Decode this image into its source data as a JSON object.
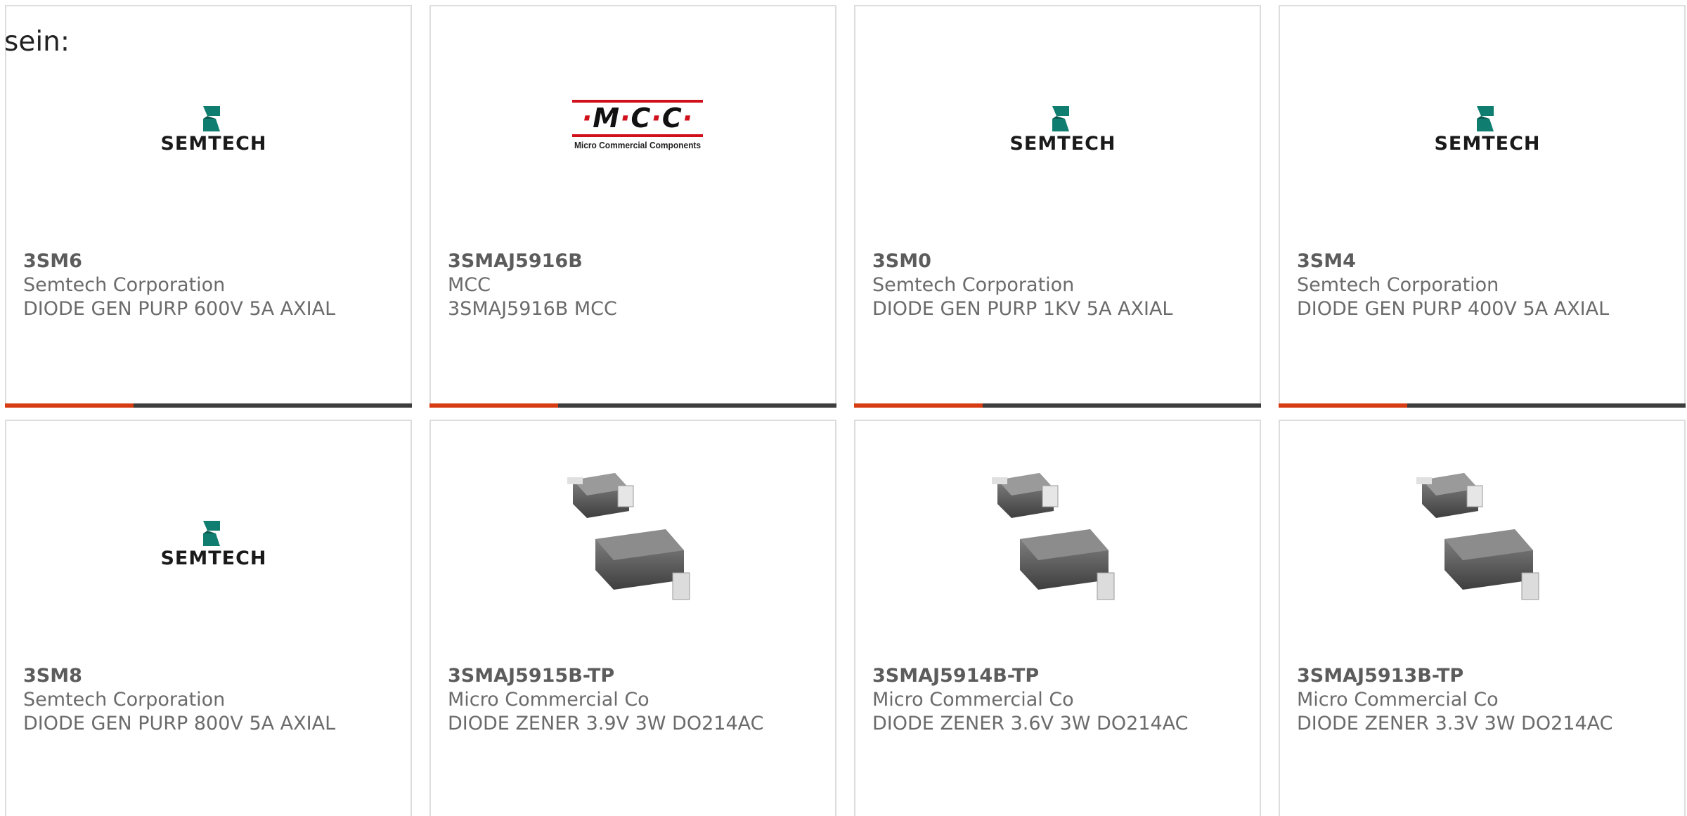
{
  "intro_text": "sein:",
  "products": [
    {
      "part": "3SM6",
      "maker": "Semtech Corporation",
      "desc": "DIODE GEN PURP 600V 5A AXIAL",
      "image": "semtech-logo"
    },
    {
      "part": "3SMAJ5916B",
      "maker": "MCC",
      "desc": "3SMAJ5916B MCC",
      "image": "mcc-logo"
    },
    {
      "part": "3SM0",
      "maker": "Semtech Corporation",
      "desc": "DIODE GEN PURP 1KV 5A AXIAL",
      "image": "semtech-logo"
    },
    {
      "part": "3SM4",
      "maker": "Semtech Corporation",
      "desc": "DIODE GEN PURP 400V 5A AXIAL",
      "image": "semtech-logo"
    },
    {
      "part": "3SM8",
      "maker": "Semtech Corporation",
      "desc": "DIODE GEN PURP 800V 5A AXIAL",
      "image": "semtech-logo"
    },
    {
      "part": "3SMAJ5915B-TP",
      "maker": "Micro Commercial Co",
      "desc": "DIODE ZENER 3.9V 3W DO214AC",
      "image": "diode-package-photo"
    },
    {
      "part": "3SMAJ5914B-TP",
      "maker": "Micro Commercial Co",
      "desc": "DIODE ZENER 3.6V 3W DO214AC",
      "image": "diode-package-photo"
    },
    {
      "part": "3SMAJ5913B-TP",
      "maker": "Micro Commercial Co",
      "desc": "DIODE ZENER 3.3V 3W DO214AC",
      "image": "diode-package-photo"
    }
  ],
  "logos": {
    "semtech_word": "SEMTECH",
    "mcc_letters": [
      "M",
      "C",
      "C"
    ],
    "mcc_tagline": "Micro Commercial Components"
  },
  "colors": {
    "accent_bar": "#d63b13",
    "base_bar": "#3d3d3d",
    "card_border": "#dddddd",
    "semtech_teal": "#0f7d6f",
    "mcc_red": "#d0101a"
  }
}
